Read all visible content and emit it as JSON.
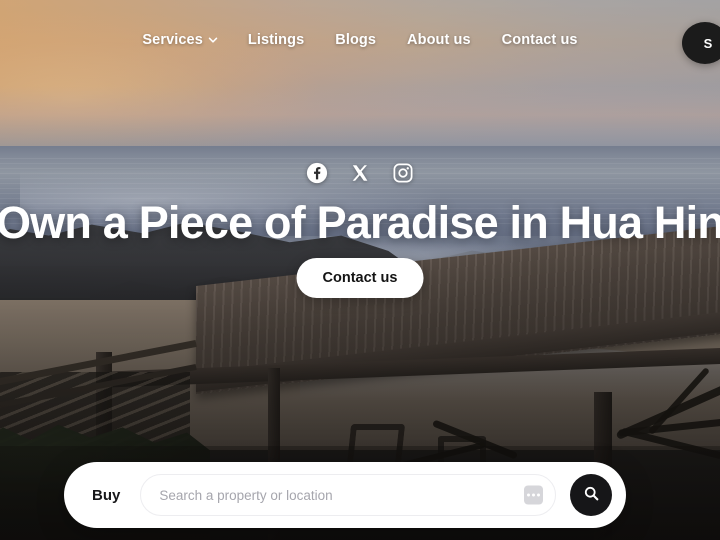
{
  "nav": {
    "items": [
      {
        "label": "Services",
        "has_dropdown": true,
        "icon": "chevron-down-icon"
      },
      {
        "label": "Listings",
        "has_dropdown": false
      },
      {
        "label": "Blogs",
        "has_dropdown": false
      },
      {
        "label": "About us",
        "has_dropdown": false
      },
      {
        "label": "Contact us",
        "has_dropdown": false
      }
    ],
    "corner_button_label": "S"
  },
  "social": {
    "items": [
      {
        "name": "facebook-icon",
        "label": "Facebook"
      },
      {
        "name": "x-twitter-icon",
        "label": "X"
      },
      {
        "name": "instagram-icon",
        "label": "Instagram"
      }
    ]
  },
  "hero": {
    "headline": "Own a Piece of Paradise in Hua Hin",
    "cta_label": "Contact us"
  },
  "search": {
    "mode_label": "Buy",
    "placeholder": "Search a property or location",
    "value": "",
    "more_icon": "more-options-icon",
    "submit_icon": "search-icon"
  },
  "colors": {
    "accent_dark": "#161618",
    "surface": "#ffffff",
    "text_dark": "#18181a",
    "placeholder": "#a6a6ad",
    "nav_text": "#ffffff"
  }
}
